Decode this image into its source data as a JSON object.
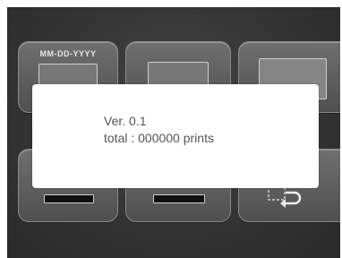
{
  "grid": {
    "date_format_label": "MM-DD-YYYY"
  },
  "dialog": {
    "version": "Ver. 0.1",
    "total": "total : 000000 prints"
  }
}
